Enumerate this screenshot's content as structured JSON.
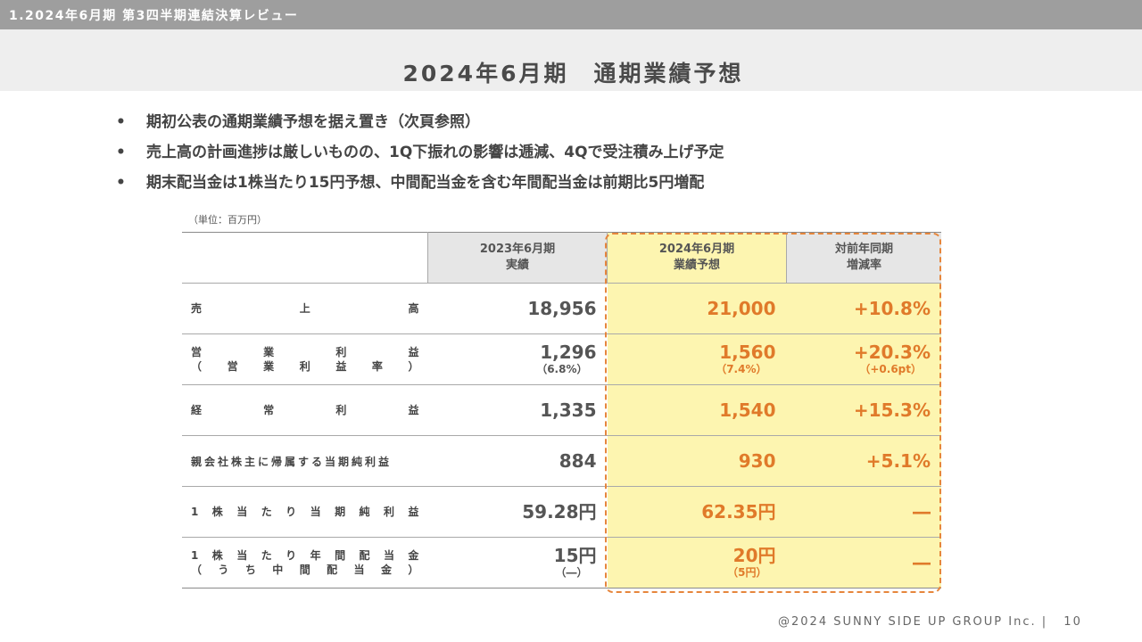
{
  "header": {
    "section": "1.2024年6月期 第3四半期連結決算レビュー",
    "title": "2024年6月期　通期業績予想"
  },
  "bullets": [
    "期初公表の通期業績予想を据え置き（次頁参照）",
    "売上高の計画進捗は厳しいものの、1Q下振れの影響は逓減、4Qで受注積み上げ予定",
    "期末配当金は1株当たり15円予想、中間配当金を含む年間配当金は前期比5円増配"
  ],
  "bullet_mark": "•",
  "table": {
    "unit_note": "（単位：百万円）",
    "headers": {
      "col1": [
        "2023年6月期",
        "実績"
      ],
      "col2": [
        "2024年6月期",
        "業績予想"
      ],
      "col3": [
        "対前年同期",
        "増減率"
      ]
    },
    "rows": [
      {
        "label": [
          "売",
          "上",
          "高"
        ],
        "actual": "18,956",
        "forecast": "21,000",
        "change": "+10.8%"
      },
      {
        "label": [
          "営",
          "業",
          "利",
          "益"
        ],
        "label2": [
          "（",
          "営",
          "業",
          "利",
          "益",
          "率",
          "）"
        ],
        "actual": "1,296",
        "actual_sub": "（6.8%）",
        "forecast": "1,560",
        "forecast_sub": "（7.4%）",
        "change": "+20.3%",
        "change_sub": "（+0.6pt）"
      },
      {
        "label": [
          "経",
          "常",
          "利",
          "益"
        ],
        "actual": "1,335",
        "forecast": "1,540",
        "change": "+15.3%"
      },
      {
        "label_text": "親会社株主に帰属する当期純利益",
        "actual": "884",
        "forecast": "930",
        "change": "+5.1%"
      },
      {
        "label": [
          "1",
          "株",
          "当",
          "た",
          "り",
          "当",
          "期",
          "純",
          "利",
          "益"
        ],
        "actual": "59.28円",
        "forecast": "62.35円",
        "change": "―"
      },
      {
        "label": [
          "1",
          "株",
          "当",
          "た",
          "り",
          "年",
          "間",
          "配",
          "当",
          "金"
        ],
        "label2": [
          "（",
          "う",
          "ち",
          "中",
          "間",
          "配",
          "当",
          "金",
          "）"
        ],
        "actual": "15円",
        "actual_sub": "（―）",
        "forecast": "20円",
        "forecast_sub": "（5円）",
        "change": "―"
      }
    ]
  },
  "footer": {
    "copyright": "@2024 SUNNY SIDE UP GROUP Inc.",
    "separator": "|",
    "page": "10"
  },
  "colors": {
    "accent": "#e07a2a",
    "highlight": "#fdf5b0",
    "frame": "#e6863c",
    "topbar": "#9e9e9e"
  }
}
